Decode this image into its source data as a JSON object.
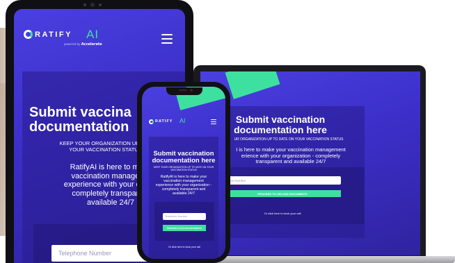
{
  "brand": {
    "logo_text": "RATIFY",
    "logo_ai": "AI",
    "logo_o": "O",
    "tagline": "powered by",
    "tagline_brand": "Accelerate"
  },
  "hero": {
    "title_line1": "Submit vaccination",
    "title_line2": "documentation here",
    "tablet_title_line1": "Submit vaccina",
    "tablet_title_line2": "documentation",
    "subtitle_full": "KEEP YOUR ORGANIZATION UP TO DATE ON YOUR VACCINATION STATUS",
    "laptop_subtitle": "UR ORGANIZATION UP TO DATE ON YOUR VACCINATION STATUS",
    "tablet_subtitle_l1": "KEEP YOUR ORGANIZATION UP TO",
    "tablet_subtitle_l2": "YOUR VACCINATION STATU",
    "phone_subtitle_l1": "KEEP YOUR ORGANIZATION UP TO DATE ON YOUR",
    "phone_subtitle_l2": "VACCINATION STATUS"
  },
  "description": {
    "laptop_l1": "I is here to make your vaccination management",
    "laptop_l2": "erience with your organization - completely",
    "laptop_l3": "transparent and available 24/7",
    "tablet_l1": "RatifyAI is here to make",
    "tablet_l2": "vaccination manageme",
    "tablet_l3": "experience with your organi",
    "tablet_l4": "completely transparent",
    "tablet_l5": "available 24/7",
    "phone_l1": "RatifyAI is here to make your",
    "phone_l2": "vaccination management",
    "phone_l3": "experience with your organization -",
    "phone_l4": "completely transparent and",
    "phone_l5": "available 24/7"
  },
  "form": {
    "phone_placeholder": "Telephone Number",
    "laptop_placeholder": "hone Number",
    "proceed_button": "PROCEED TO UPLOAD DOCUMENTS",
    "book_call_link": "Or click here to book your call"
  },
  "colors": {
    "primary": "#4a3fe0",
    "accent": "#3ee0a0",
    "text": "#ffffff"
  },
  "icons": {
    "menu": "hamburger-menu-icon"
  }
}
